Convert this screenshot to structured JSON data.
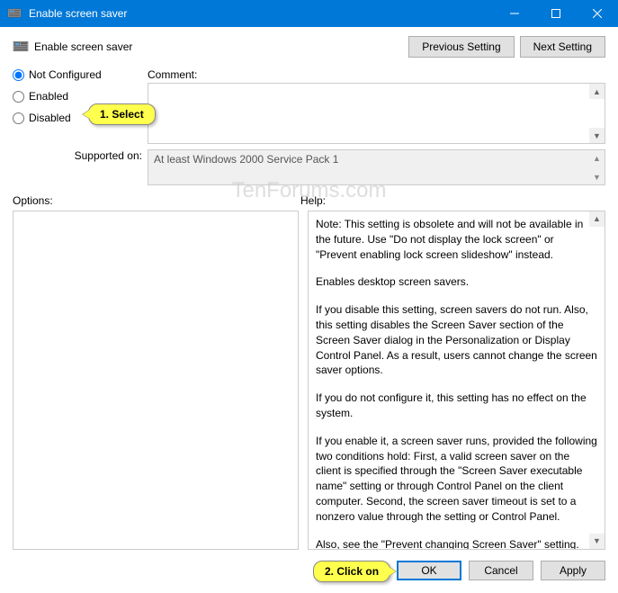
{
  "window": {
    "title": "Enable screen saver"
  },
  "header": {
    "title": "Enable screen saver",
    "prev_btn": "Previous Setting",
    "next_btn": "Next Setting"
  },
  "radios": {
    "not_configured": "Not Configured",
    "enabled": "Enabled",
    "disabled": "Disabled"
  },
  "labels": {
    "comment": "Comment:",
    "supported": "Supported on:",
    "options": "Options:",
    "help": "Help:"
  },
  "supported_text": "At least Windows 2000 Service Pack 1",
  "help": {
    "p1": "Note: This setting is obsolete and will not be available in the future. Use \"Do not display the lock screen\" or \"Prevent enabling lock screen slideshow\" instead.",
    "p2": "Enables desktop screen savers.",
    "p3": "If you disable this setting, screen savers do not run. Also, this setting disables the Screen Saver section of the Screen Saver dialog in the Personalization or Display Control Panel. As a result, users cannot change the screen saver options.",
    "p4": "If you do not configure it, this setting has no effect on the system.",
    "p5": "If you enable it, a screen saver runs, provided the following two conditions hold: First, a valid screen saver on the client is specified through the \"Screen Saver executable name\" setting or through Control Panel on the client computer. Second, the screen saver timeout is set to a nonzero value through the setting or Control Panel.",
    "p6": "Also, see the \"Prevent changing Screen Saver\" setting."
  },
  "footer": {
    "ok": "OK",
    "cancel": "Cancel",
    "apply": "Apply"
  },
  "callouts": {
    "c1": "1. Select",
    "c2": "2. Click on"
  },
  "watermark": "TenForums.com"
}
